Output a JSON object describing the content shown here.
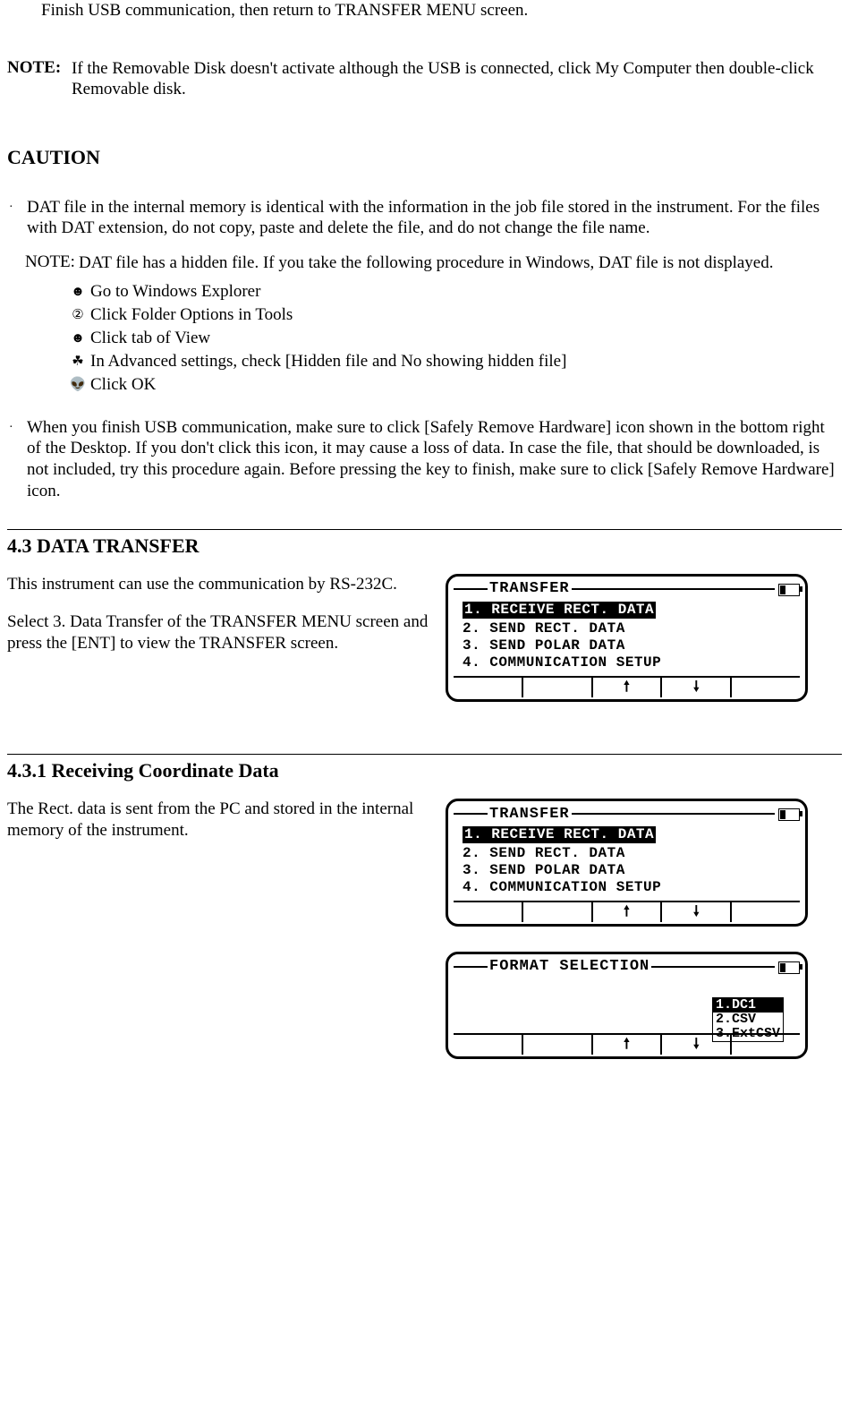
{
  "top": {
    "finish_line": "Finish USB communication, then return to TRANSFER MENU screen."
  },
  "note": {
    "label": "NOTE:",
    "text": "If the Removable Disk doesn't activate although the USB is connected, click My Computer then double-click Removable disk."
  },
  "caution": {
    "heading": "CAUTION",
    "items": [
      "DAT file in the internal memory is identical with the information in the job file stored in the instrument. For the files with DAT extension, do not copy, paste and delete the file, and do not change the file name.",
      "When you finish USB communication, make sure to click [Safely Remove Hardware] icon shown in the bottom right of the Desktop. If you don't click this icon, it may cause a loss of data. In case the file, that should be downloaded, is not included, try this procedure again. Before pressing the key to finish, make sure to click [Safely Remove Hardware] icon."
    ],
    "subnote": {
      "label": "NOTE:",
      "text": "DAT file has a hidden file. If you take the following procedure in Windows, DAT file is not displayed."
    },
    "procedure": [
      "Go to Windows Explorer",
      "Click Folder Options in Tools",
      "Click tab of View",
      "In Advanced settings, check [Hidden file and No showing hidden file]",
      "Click OK"
    ],
    "procedure_icons": [
      "person-icon",
      "circled-2-icon",
      "person-icon",
      "leaf-icon",
      "alien-icon"
    ]
  },
  "section43": {
    "heading": "4.3 DATA TRANSFER",
    "para1": "This instrument can use the communication by RS-232C.",
    "para2": "Select 3. Data Transfer of the TRANSFER MENU screen and press the [ENT] to view the TRANSFER screen."
  },
  "section431": {
    "heading": "4.3.1 Receiving Coordinate Data",
    "para1": "The Rect. data is sent from the PC and stored in the internal memory of the instrument."
  },
  "lcd_transfer": {
    "title": "TRANSFER",
    "items": [
      "1. RECEIVE RECT. DATA",
      "2. SEND RECT. DATA",
      "3. SEND POLAR DATA",
      "4. COMMUNICATION SETUP"
    ],
    "selected_index": 0,
    "softkeys": [
      "",
      "",
      "↑",
      "↓",
      ""
    ],
    "arrow_up": "🠕",
    "arrow_down": "🠗"
  },
  "lcd_format": {
    "title": "FORMAT SELECTION",
    "options": [
      "1.DC1",
      "2.CSV",
      "3.ExtCSV"
    ],
    "selected_index": 0,
    "arrow_up": "🠕",
    "arrow_down": "🠗"
  },
  "glyphs": {
    "person": "☻",
    "circled2": "②",
    "leaf": "☘",
    "alien": "👽",
    "bullet": "·"
  }
}
